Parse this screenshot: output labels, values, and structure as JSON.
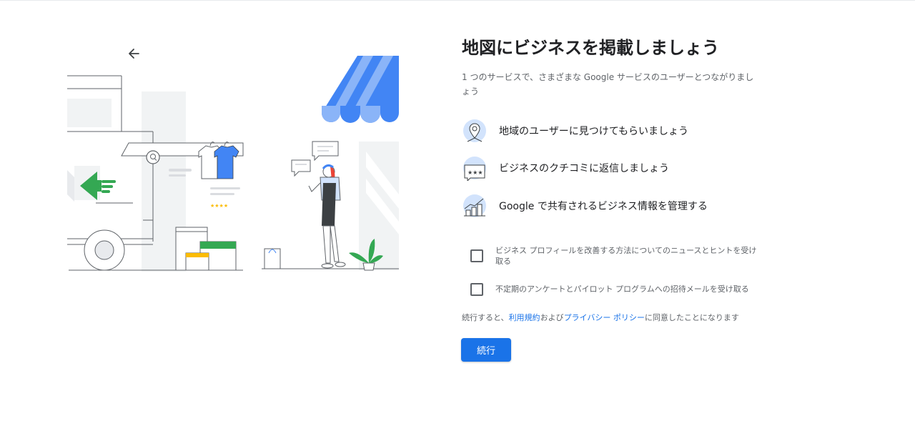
{
  "page": {
    "title": "地図にビジネスを掲載しましょう",
    "subtitle": "1 つのサービスで、さまざまな Google サービスのユーザーとつながりましょう"
  },
  "benefits": [
    {
      "icon": "map-pin-icon",
      "text": "地域のユーザーに見つけてもらいましょう"
    },
    {
      "icon": "review-stars-icon",
      "text": "ビジネスのクチコミに返信しましょう"
    },
    {
      "icon": "chart-icon",
      "text": "Google で共有されるビジネス情報を管理する"
    }
  ],
  "options": [
    {
      "label": "ビジネス プロフィールを改善する方法についてのニュースとヒントを受け取る",
      "checked": false
    },
    {
      "label": "不定期のアンケートとパイロット プログラムへの招待メールを受け取る",
      "checked": false
    }
  ],
  "legal": {
    "prefix": "続行すると、",
    "terms_link": "利用規約",
    "middle": "および",
    "privacy_link": "プライバシー ポリシー",
    "suffix": "に同意したことになります"
  },
  "continue_label": "続行",
  "colors": {
    "primary": "#1a73e8",
    "green": "#34a853",
    "yellow": "#fbbc04",
    "illustration_light_blue": "#d2e3fc"
  }
}
